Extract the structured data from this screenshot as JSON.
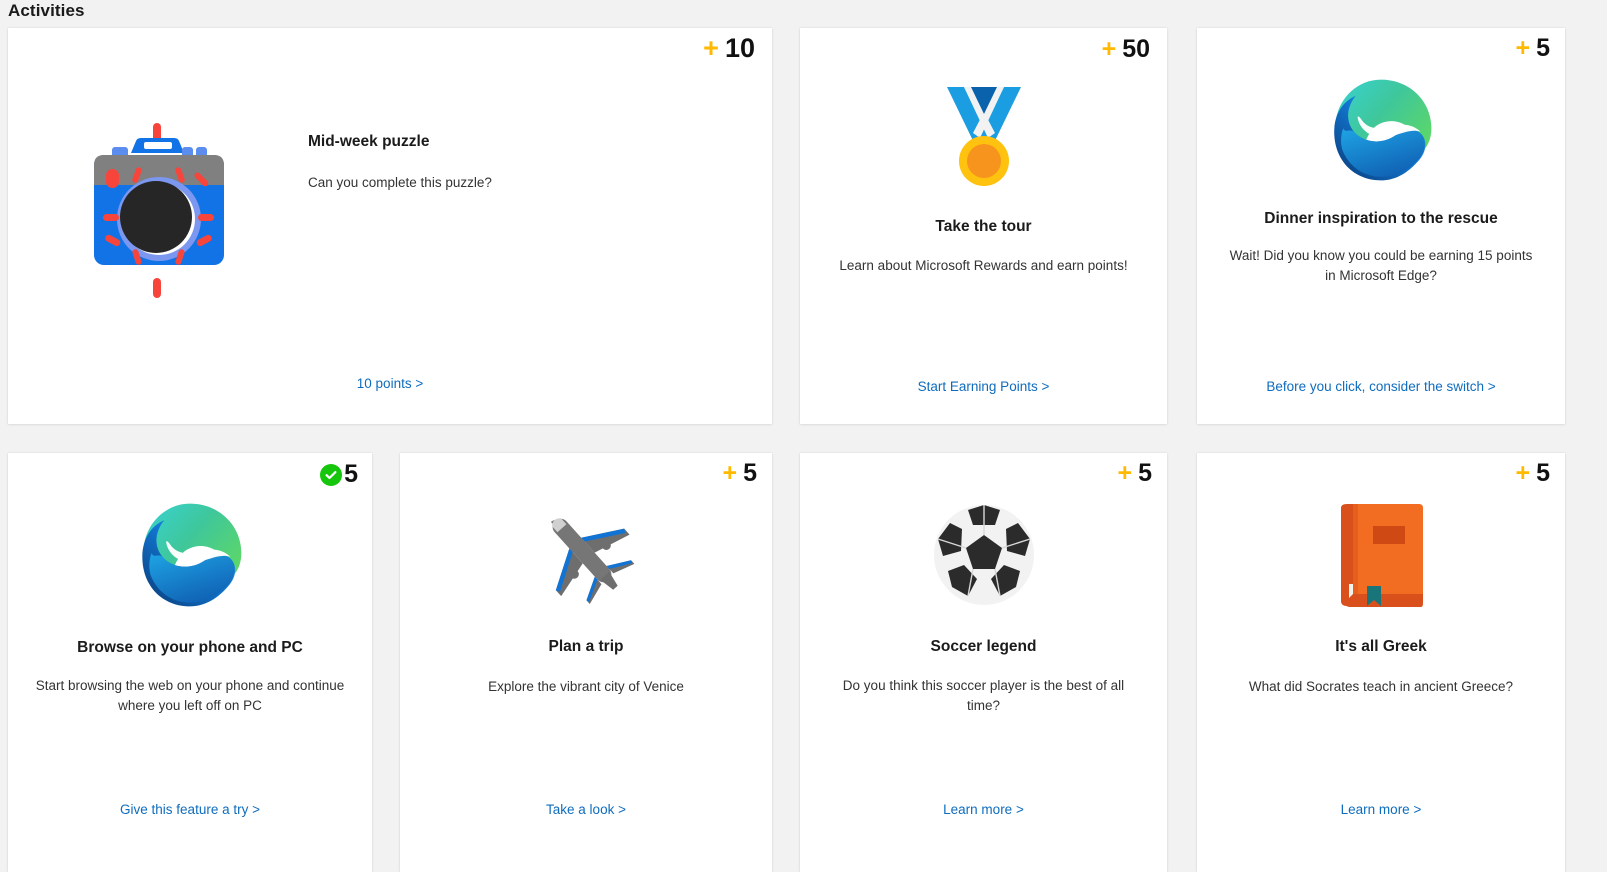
{
  "section": {
    "title": "Activities"
  },
  "colors": {
    "page_background": "#f2f2f2",
    "card_background": "#ffffff",
    "points_plus": "#ffb900",
    "link": "#0f6cbd",
    "completed_check": "#16c60c",
    "edge_blue": "#0f6cbd",
    "book_orange": "#ef6221"
  },
  "row1": [
    {
      "points": "10",
      "points_prefix": "+",
      "icon": "camera-icon",
      "title": "Mid-week puzzle",
      "description": "Can you complete this puzzle?",
      "cta": "10 points  >"
    },
    {
      "points": "50",
      "points_prefix": "+",
      "icon": "medal-icon",
      "title": "Take the tour",
      "description": "Learn about Microsoft Rewards and earn points!",
      "cta": "Start Earning Points  >"
    },
    {
      "points": "5",
      "points_prefix": "+",
      "icon": "edge-logo-icon",
      "title": "Dinner inspiration to the rescue",
      "description": "Wait! Did you know you could be earning 15 points in Microsoft Edge?",
      "cta": "Before you click, consider the switch  >"
    }
  ],
  "row2": [
    {
      "points": "5",
      "points_prefix": "check",
      "completed": true,
      "icon": "edge-logo-icon",
      "title": "Browse on your phone and PC",
      "description": "Start browsing the web on your phone and continue where you left off on PC",
      "cta": "Give this feature a try  >"
    },
    {
      "points": "5",
      "points_prefix": "+",
      "completed": false,
      "icon": "airplane-icon",
      "title": "Plan a trip",
      "description": "Explore the vibrant city of Venice",
      "cta": "Take a look  >"
    },
    {
      "points": "5",
      "points_prefix": "+",
      "completed": false,
      "icon": "soccer-ball-icon",
      "title": "Soccer legend",
      "description": "Do you think this soccer player is the best of all time?",
      "cta": "Learn more  >"
    },
    {
      "points": "5",
      "points_prefix": "+",
      "completed": false,
      "icon": "book-icon",
      "title": "It's all Greek",
      "description": "What did Socrates teach in ancient Greece?",
      "cta": "Learn more  >"
    }
  ]
}
